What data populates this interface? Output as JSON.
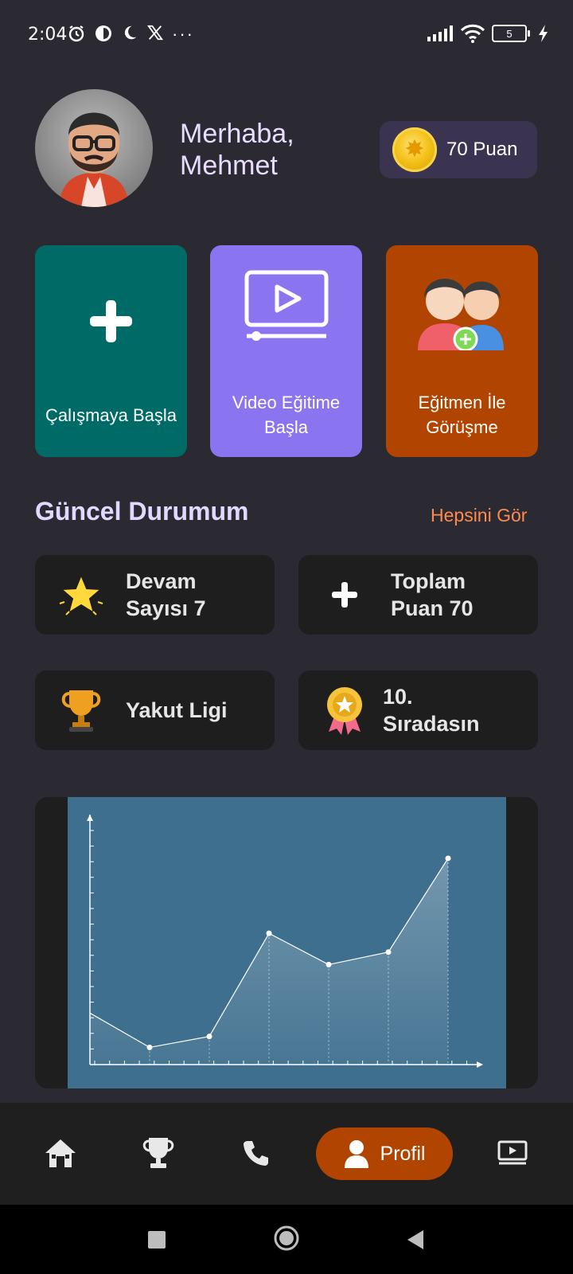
{
  "status_bar": {
    "time": "2:04",
    "battery": "5"
  },
  "header": {
    "greeting": "Merhaba,",
    "name": "Mehmet",
    "points_label": "70 Puan"
  },
  "cards": [
    {
      "label": "Çalışmaya Başla",
      "icon": "plus-icon",
      "color": "#006b66"
    },
    {
      "label_line1": "Video Eğitime",
      "label_line2": "Başla",
      "icon": "video-play-icon",
      "color": "#8b74ef"
    },
    {
      "label_line1": "Eğitmen İle",
      "label_line2": "Görüşme",
      "icon": "users-add-icon",
      "color": "#b14400"
    }
  ],
  "section": {
    "title": "Güncel Durumum",
    "see_all": "Hepsini Gör"
  },
  "stats": [
    {
      "line1": "Devam",
      "line2": "Sayısı 7",
      "icon": "star-icon"
    },
    {
      "line1": "Toplam",
      "line2": "Puan 70",
      "icon": "plus-icon"
    },
    {
      "line1": "Yakut Ligi",
      "icon": "trophy-icon"
    },
    {
      "line1": "10.",
      "line2": "Sıradasın",
      "icon": "medal-icon"
    }
  ],
  "chart_data": {
    "type": "area",
    "x": [
      1,
      2,
      3,
      4,
      5,
      6,
      7
    ],
    "values": [
      3.3,
      1.1,
      1.8,
      8.4,
      6.4,
      7.2,
      13.2
    ],
    "ylim": [
      0,
      16
    ],
    "title": "",
    "xlabel": "",
    "ylabel": ""
  },
  "nav": {
    "items": [
      {
        "name": "home",
        "icon": "home-icon"
      },
      {
        "name": "leaderboard",
        "icon": "trophy-icon"
      },
      {
        "name": "call",
        "icon": "phone-icon"
      },
      {
        "name": "profile",
        "icon": "user-icon",
        "label": "Profil",
        "active": true
      },
      {
        "name": "videos",
        "icon": "video-icon"
      }
    ]
  },
  "colors": {
    "background": "#2b2a33",
    "accent_orange": "#b14400",
    "link_orange": "#ff8a4c",
    "title_lavender": "#e3d8ff"
  }
}
